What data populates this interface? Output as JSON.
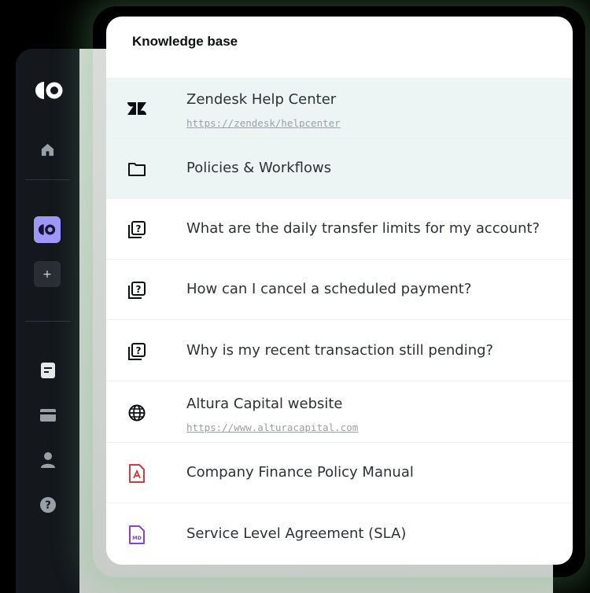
{
  "colors": {
    "accent": "#9f97ff",
    "highlight_row": "#edf4f4",
    "pdf_icon": "#d13a3a",
    "md_icon": "#8a3fd1",
    "glow": "#6ebe78"
  },
  "sidebar": {
    "logo": "brand-logo",
    "items": [
      {
        "icon": "home-icon"
      },
      {
        "icon": "workspace-logo-icon"
      },
      {
        "icon": "plus-icon",
        "label": "+"
      },
      {
        "icon": "document-icon"
      },
      {
        "icon": "credit-card-icon"
      },
      {
        "icon": "user-icon"
      },
      {
        "icon": "help-icon"
      }
    ]
  },
  "knowledge_base": {
    "title": "Knowledge base",
    "items": [
      {
        "icon": "zendesk-icon",
        "label": "Zendesk Help Center",
        "link": "https://zendesk/helpcenter"
      },
      {
        "icon": "folder-icon",
        "label": "Policies & Workflows"
      },
      {
        "icon": "faq-icon",
        "label": "What are the daily transfer limits for my account?"
      },
      {
        "icon": "faq-icon",
        "label": "How can I cancel a scheduled payment?"
      },
      {
        "icon": "faq-icon",
        "label": "Why is my recent transaction still pending?"
      },
      {
        "icon": "globe-icon",
        "label": "Altura Capital website",
        "link": "https://www.alturacapital.com"
      },
      {
        "icon": "pdf-file-icon",
        "label": "Company Finance Policy Manual"
      },
      {
        "icon": "markdown-file-icon",
        "label": "Service Level Agreement (SLA)"
      }
    ]
  }
}
